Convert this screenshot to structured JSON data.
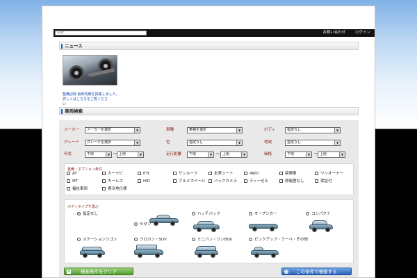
{
  "header": {
    "search_placeholder": "検索",
    "links": [
      "お問い合わせ",
      "ログイン"
    ]
  },
  "sections": {
    "news_title": "ニュース",
    "search_title": "車両検索"
  },
  "news": {
    "image_icon": "car-undercarriage-photo",
    "caption": "整備記録 最新情報を掲載しました。詳しくはこちらをご覧くださ\nい"
  },
  "form": {
    "rows": [
      {
        "fields": [
          {
            "label": "メーカー",
            "value": "メーカーを選択"
          },
          {
            "label": "車種",
            "value": "車種を選択"
          },
          {
            "label": "ボディ",
            "value": "指定なし"
          }
        ]
      },
      {
        "fields": [
          {
            "label": "グレード",
            "value": "グレードを選択"
          },
          {
            "label": "色",
            "value": "指定なし"
          },
          {
            "label": "地域",
            "value": "指定なし"
          }
        ]
      },
      {
        "fields": [
          {
            "label": "年式",
            "from": "下限",
            "to": "上限"
          },
          {
            "label": "走行距離",
            "from": "下限",
            "to": "上限"
          },
          {
            "label": "価格",
            "from": "下限",
            "to": "上限"
          }
        ]
      }
    ],
    "tilde": "～",
    "options_title": "装備・オプション条件",
    "options": [
      "AT",
      "カーナビ",
      "ETC",
      "サンルーフ",
      "本革シート",
      "4WD",
      "禁煙車",
      "ワンオーナー",
      "MT",
      "キーレス",
      "HID",
      "アルミホイール",
      "バックカメラ",
      "ディーゼル",
      "修復歴なし",
      "保証付"
    ],
    "options_extra": [
      "福祉車両",
      "寒冷地仕様"
    ],
    "bodytype_title": "ボディタイプで選ぶ",
    "bodytypes": [
      {
        "label": "指定なし",
        "checked": true
      },
      {
        "label": "セダン",
        "checked": false
      },
      {
        "label": "ハッチバック",
        "checked": false
      },
      {
        "label": "オープンカー",
        "checked": false
      },
      {
        "label": "コンパクト",
        "checked": false
      },
      {
        "label": "ステーションワゴン",
        "checked": false
      },
      {
        "label": "クロカン・SUV",
        "checked": false
      },
      {
        "label": "ミニバン・ワンBOX",
        "checked": false
      },
      {
        "label": "ピックアップ・クーペ・その他",
        "checked": false
      }
    ],
    "car_color": "#6f93a8",
    "clear_label": "検索条件をクリア",
    "search_label": "この条件で検索する"
  }
}
